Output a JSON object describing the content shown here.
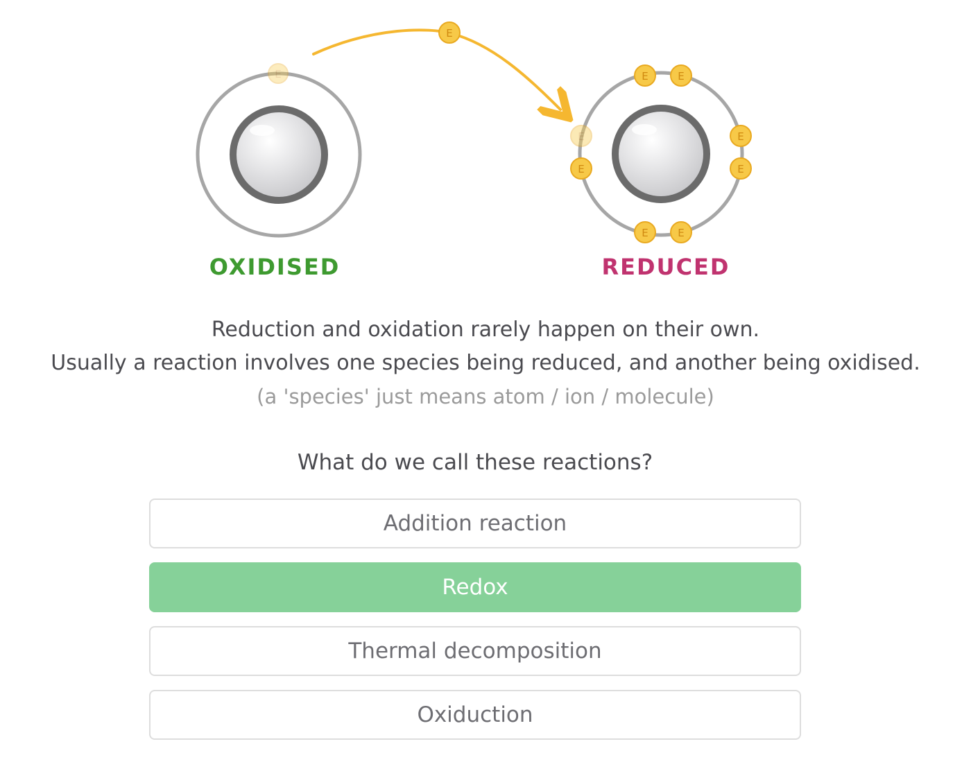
{
  "diagram": {
    "left_atom_label": "OXIDISED",
    "right_atom_label": "REDUCED",
    "electron_symbol": "E",
    "colors": {
      "oxidised": "#3e9a30",
      "reduced": "#c0336f",
      "electron": "#f7c948",
      "arrow": "#f5b730"
    }
  },
  "explanation": {
    "line1": "Reduction and oxidation rarely happen on their own.",
    "line2": "Usually a reaction involves one species being reduced, and another being oxidised.",
    "note": "(a 'species' just means atom / ion / molecule)"
  },
  "question": "What do we call these reactions?",
  "options": [
    {
      "label": "Addition reaction",
      "selected": false
    },
    {
      "label": "Redox",
      "selected": true
    },
    {
      "label": "Thermal decomposition",
      "selected": false
    },
    {
      "label": "Oxiduction",
      "selected": false
    }
  ],
  "colors": {
    "selected_option": "#86d199"
  }
}
